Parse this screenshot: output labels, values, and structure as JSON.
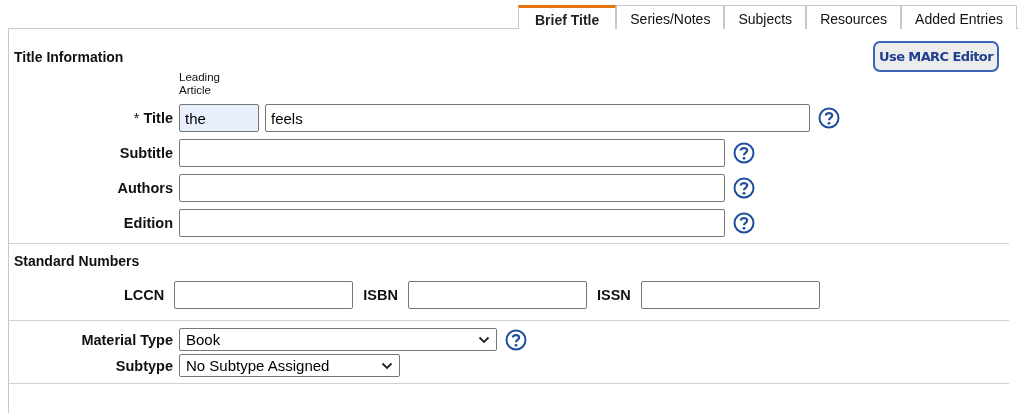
{
  "tabs": [
    {
      "label": "Brief Title",
      "selected": true
    },
    {
      "label": "Series/Notes",
      "selected": false
    },
    {
      "label": "Subjects",
      "selected": false
    },
    {
      "label": "Resources",
      "selected": false
    },
    {
      "label": "Added Entries",
      "selected": false
    }
  ],
  "title_information": {
    "heading": "Title Information",
    "marc_button": "Use MARC Editor",
    "leading_article_caption": "Leading Article",
    "fields": [
      {
        "kind": "title",
        "label": "Title",
        "required_mark": "*",
        "leading_article": "the",
        "value": "feels"
      },
      {
        "kind": "plain",
        "label": "Subtitle"
      },
      {
        "kind": "plain",
        "label": "Authors"
      },
      {
        "kind": "plain",
        "label": "Edition"
      }
    ]
  },
  "standard_numbers": {
    "heading": "Standard Numbers",
    "fields": [
      {
        "label": "LCCN"
      },
      {
        "label": "ISBN"
      },
      {
        "label": "ISSN"
      }
    ]
  },
  "material": [
    {
      "label": "Material Type",
      "value": "Book",
      "help": true
    },
    {
      "label": "Subtype",
      "value": "No Subtype Assigned",
      "help": false
    }
  ]
}
